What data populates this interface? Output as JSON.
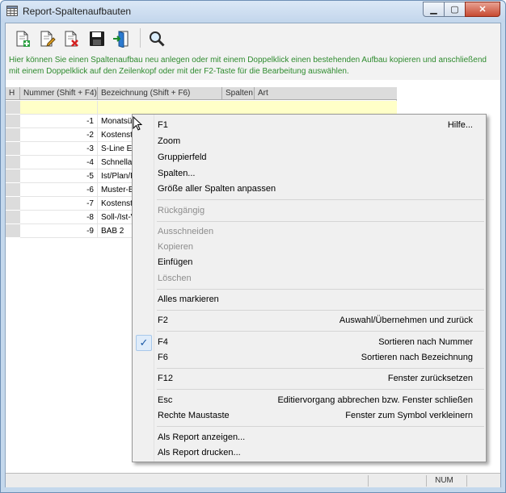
{
  "window": {
    "title": "Report-Spaltenaufbauten",
    "min_glyph": "▁",
    "max_glyph": "▢",
    "close_glyph": "✕"
  },
  "toolbar": {
    "buttons": [
      {
        "name": "new-layout-button",
        "icon": "new-document-icon"
      },
      {
        "name": "edit-layout-button",
        "icon": "edit-document-icon"
      },
      {
        "name": "delete-layout-button",
        "icon": "delete-document-icon"
      },
      {
        "name": "save-button",
        "icon": "save-icon"
      },
      {
        "name": "exit-button",
        "icon": "exit-door-icon"
      },
      {
        "name": "search-button",
        "icon": "search-icon"
      }
    ]
  },
  "hint": "Hier können Sie einen Spaltenaufbau neu anlegen oder mit einem Doppelklick einen bestehenden Aufbau kopieren und anschließend mit einem Doppelklick auf den Zeilenkopf oder mit der F2-Taste für die Bearbeitung auswählen.",
  "grid": {
    "headers": {
      "marker": "H",
      "number": "Nummer (Shift + F4)",
      "name": "Bezeichnung (Shift + F6)",
      "columns": "Spalten",
      "type": "Art"
    },
    "rows": [
      {
        "number": "-1",
        "name": "Monatsüb"
      },
      {
        "number": "-2",
        "name": "Kostenste"
      },
      {
        "number": "-3",
        "name": "S-Line Ein"
      },
      {
        "number": "-4",
        "name": "Schnellan"
      },
      {
        "number": "-5",
        "name": "Ist/Plan/Pr"
      },
      {
        "number": "-6",
        "name": "Muster-BA"
      },
      {
        "number": "-7",
        "name": "Kostenste"
      },
      {
        "number": "-8",
        "name": "Soll-/Ist-V"
      },
      {
        "number": "-9",
        "name": "BAB 2"
      }
    ]
  },
  "statusbar": {
    "num": "NUM"
  },
  "context_menu": {
    "items": [
      {
        "label": "F1",
        "accel": "Hilfe...",
        "disabled": false
      },
      {
        "label": "Zoom",
        "accel": "",
        "disabled": false
      },
      {
        "label": "Gruppierfeld",
        "accel": "",
        "disabled": false
      },
      {
        "label": "Spalten...",
        "accel": "",
        "disabled": false
      },
      {
        "label": "Größe aller Spalten anpassen",
        "accel": "",
        "disabled": false
      },
      {
        "label": "Rückgängig",
        "accel": "",
        "disabled": true
      },
      {
        "label": "Ausschneiden",
        "accel": "",
        "disabled": true
      },
      {
        "label": "Kopieren",
        "accel": "",
        "disabled": true
      },
      {
        "label": "Einfügen",
        "accel": "",
        "disabled": false
      },
      {
        "label": "Löschen",
        "accel": "",
        "disabled": true
      },
      {
        "label": "Alles markieren",
        "accel": "",
        "disabled": false
      },
      {
        "label": "F2",
        "accel": "Auswahl/Übernehmen und zurück",
        "disabled": false
      },
      {
        "label": "F4",
        "accel": "Sortieren nach Nummer",
        "disabled": false,
        "checked": true
      },
      {
        "label": "F6",
        "accel": "Sortieren nach Bezeichnung",
        "disabled": false
      },
      {
        "label": "F12",
        "accel": "Fenster zurücksetzen",
        "disabled": false
      },
      {
        "label": "Esc",
        "accel": "Editiervorgang abbrechen bzw. Fenster schließen",
        "disabled": false
      },
      {
        "label": "Rechte Maustaste",
        "accel": "Fenster zum Symbol verkleinern",
        "disabled": false
      },
      {
        "label": "Als Report anzeigen...",
        "accel": "",
        "disabled": false
      },
      {
        "label": "Als Report drucken...",
        "accel": "",
        "disabled": false
      }
    ],
    "check_glyph": "✓"
  }
}
